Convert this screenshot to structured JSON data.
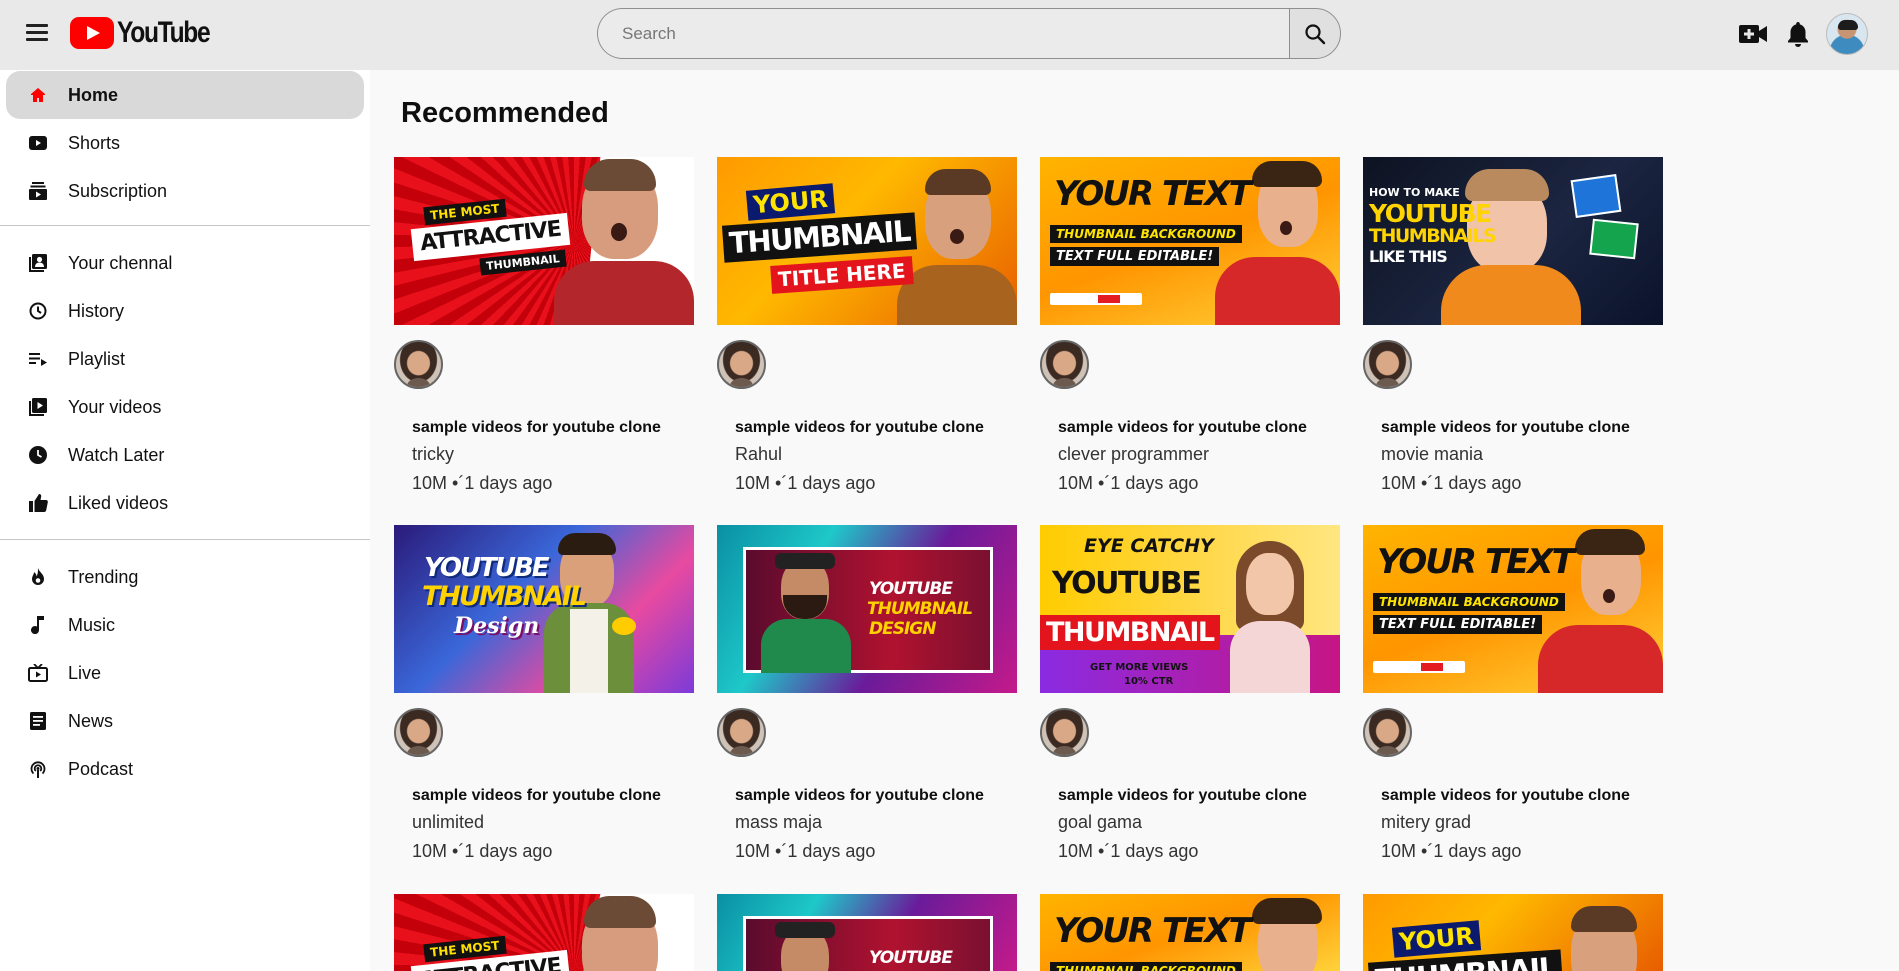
{
  "header": {
    "logo_text": "YouTube",
    "search_placeholder": "Search"
  },
  "sidebar": {
    "items": [
      {
        "label": "Home",
        "icon": "home-icon",
        "active": true
      },
      {
        "label": "Shorts",
        "icon": "shorts-icon"
      },
      {
        "label": "Subscription",
        "icon": "subscriptions-icon"
      },
      {
        "label": "Your chennal",
        "icon": "your-channel-icon"
      },
      {
        "label": "History",
        "icon": "history-icon"
      },
      {
        "label": "Playlist",
        "icon": "playlist-icon"
      },
      {
        "label": "Your videos",
        "icon": "your-videos-icon"
      },
      {
        "label": "Watch Later",
        "icon": "watch-later-icon"
      },
      {
        "label": "Liked videos",
        "icon": "liked-icon"
      },
      {
        "label": "Trending",
        "icon": "trending-icon"
      },
      {
        "label": "Music",
        "icon": "music-icon"
      },
      {
        "label": "Live",
        "icon": "live-icon"
      },
      {
        "label": "News",
        "icon": "news-icon"
      },
      {
        "label": "Podcast",
        "icon": "podcast-icon"
      }
    ]
  },
  "main": {
    "section_title": "Recommended",
    "videos": [
      {
        "title": "sample videos for youtube clone",
        "channel": "tricky",
        "meta": "10M •´1 days ago",
        "thumb_text": [
          "THE MOST",
          "ATTRACTIVE",
          "THUMBNAIL"
        ]
      },
      {
        "title": "sample videos for youtube clone",
        "channel": "Rahul",
        "meta": "10M •´1 days ago",
        "thumb_text": [
          "YOUR",
          "THUMBNAIL",
          "TITLE HERE"
        ]
      },
      {
        "title": "sample videos for youtube clone",
        "channel": "clever programmer",
        "meta": "10M •´1 days ago",
        "thumb_text": [
          "YOUR TEXT",
          "THUMBNAIL BACKGROUND",
          "TEXT FULL EDITABLE!"
        ]
      },
      {
        "title": "sample videos for youtube clone",
        "channel": "movie mania",
        "meta": "10M •´1 days ago",
        "thumb_text": [
          "HOW TO MAKE",
          "YOUTUBE",
          "THUMBNAILS",
          "LIKE THIS"
        ]
      },
      {
        "title": "sample videos for youtube clone",
        "channel": "unlimited",
        "meta": "10M •´1 days ago",
        "thumb_text": [
          "YOUTUBE",
          "THUMBNAIL",
          "Design"
        ]
      },
      {
        "title": "sample videos for youtube clone",
        "channel": "mass maja",
        "meta": "10M •´1 days ago",
        "thumb_text": [
          "YOUTUBE",
          "THUMBNAIL",
          "DESIGN"
        ]
      },
      {
        "title": "sample videos for youtube clone",
        "channel": "goal gama",
        "meta": "10M •´1 days ago",
        "thumb_text": [
          "EYE CATCHY",
          "YOUTUBE",
          "THUMBNAIL",
          "GET MORE VIEWS",
          "10% CTR"
        ]
      },
      {
        "title": "sample videos for youtube clone",
        "channel": "mitery grad",
        "meta": "10M •´1 days ago",
        "thumb_text": [
          "YOUR TEXT",
          "THUMBNAIL BACKGROUND",
          "TEXT FULL EDITABLE!"
        ]
      }
    ],
    "third_row_thumbs": [
      {
        "thumb_text": [
          "THE MOST",
          "ATTRACTIVE"
        ]
      },
      {
        "thumb_text": [
          "YOUTUBE"
        ]
      },
      {
        "thumb_text": [
          "YOUR TEXT",
          "THUMBNAIL BACKGROUND"
        ]
      },
      {
        "thumb_text": [
          "YOUR",
          "THUMBNAIL"
        ]
      }
    ]
  }
}
